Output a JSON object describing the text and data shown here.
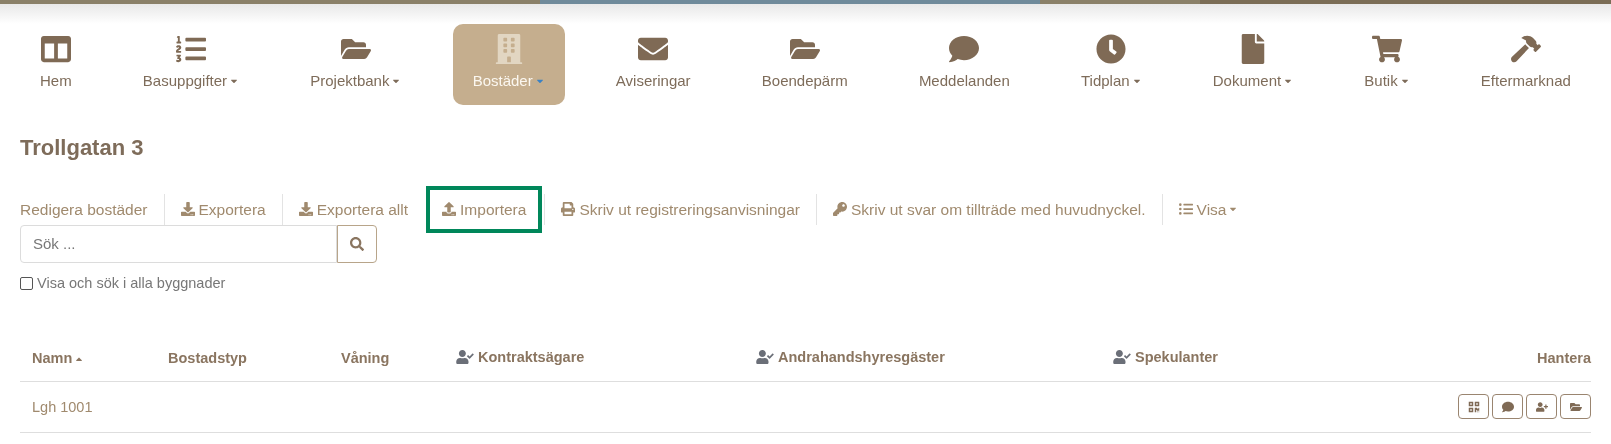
{
  "nav": [
    {
      "label": "Hem",
      "dropdown": false,
      "selected": false
    },
    {
      "label": "Basuppgifter",
      "dropdown": true,
      "selected": false
    },
    {
      "label": "Projektbank",
      "dropdown": true,
      "selected": false
    },
    {
      "label": "Bostäder",
      "dropdown": true,
      "selected": true
    },
    {
      "label": "Aviseringar",
      "dropdown": false,
      "selected": false
    },
    {
      "label": "Boendepärm",
      "dropdown": false,
      "selected": false
    },
    {
      "label": "Meddelanden",
      "dropdown": false,
      "selected": false
    },
    {
      "label": "Tidplan",
      "dropdown": true,
      "selected": false
    },
    {
      "label": "Dokument",
      "dropdown": true,
      "selected": false
    },
    {
      "label": "Butik",
      "dropdown": true,
      "selected": false
    },
    {
      "label": "Eftermarknad",
      "dropdown": false,
      "selected": false
    }
  ],
  "title": "Trollgatan 3",
  "toolbar": [
    {
      "label": "Redigera bostäder",
      "kind": "plain",
      "dropdown": false,
      "highlighted": false
    },
    {
      "label": "Exportera",
      "kind": "download",
      "dropdown": false,
      "highlighted": false
    },
    {
      "label": "Exportera allt",
      "kind": "download",
      "dropdown": false,
      "highlighted": false
    },
    {
      "label": "Importera",
      "kind": "upload",
      "dropdown": false,
      "highlighted": true
    },
    {
      "label": "Skriv ut registreringsanvisningar",
      "kind": "print",
      "dropdown": false,
      "highlighted": false
    },
    {
      "label": "Skriv ut svar om tillträde med huvudnyckel.",
      "kind": "key",
      "dropdown": false,
      "highlighted": false
    },
    {
      "label": "Visa",
      "kind": "list",
      "dropdown": true,
      "highlighted": false
    }
  ],
  "search": {
    "placeholder": "Sök ..."
  },
  "all_buildings": {
    "label": "Visa och sök i alla byggnader",
    "checked": false
  },
  "table": {
    "columns": [
      {
        "label": "Namn",
        "person_icon": false,
        "sorted": true
      },
      {
        "label": "Bostadstyp",
        "person_icon": false,
        "sorted": false
      },
      {
        "label": "Våning",
        "person_icon": false,
        "sorted": false
      },
      {
        "label": "Kontraktsägare",
        "person_icon": true,
        "sorted": false
      },
      {
        "label": "Andrahandshyresgäster",
        "person_icon": true,
        "sorted": false
      },
      {
        "label": "Spekulanter",
        "person_icon": true,
        "sorted": false
      },
      {
        "label": "Hantera",
        "person_icon": false,
        "sorted": false
      }
    ],
    "rows": [
      {
        "name": "Lgh 1001"
      }
    ]
  }
}
